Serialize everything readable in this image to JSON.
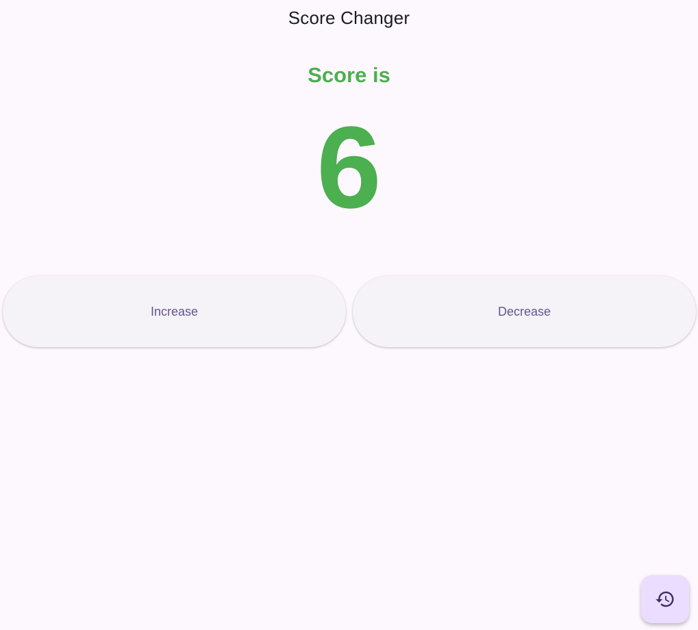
{
  "app_bar": {
    "title": "Score Changer"
  },
  "score": {
    "label": "Score is",
    "value": "6"
  },
  "actions": {
    "increase_label": "Increase",
    "decrease_label": "Decrease"
  },
  "fab": {
    "icon": "history-icon"
  },
  "colors": {
    "background": "#fdf7fe",
    "score_green": "#4caf50",
    "button_text": "#65558f",
    "fab_background": "#eaddff"
  }
}
